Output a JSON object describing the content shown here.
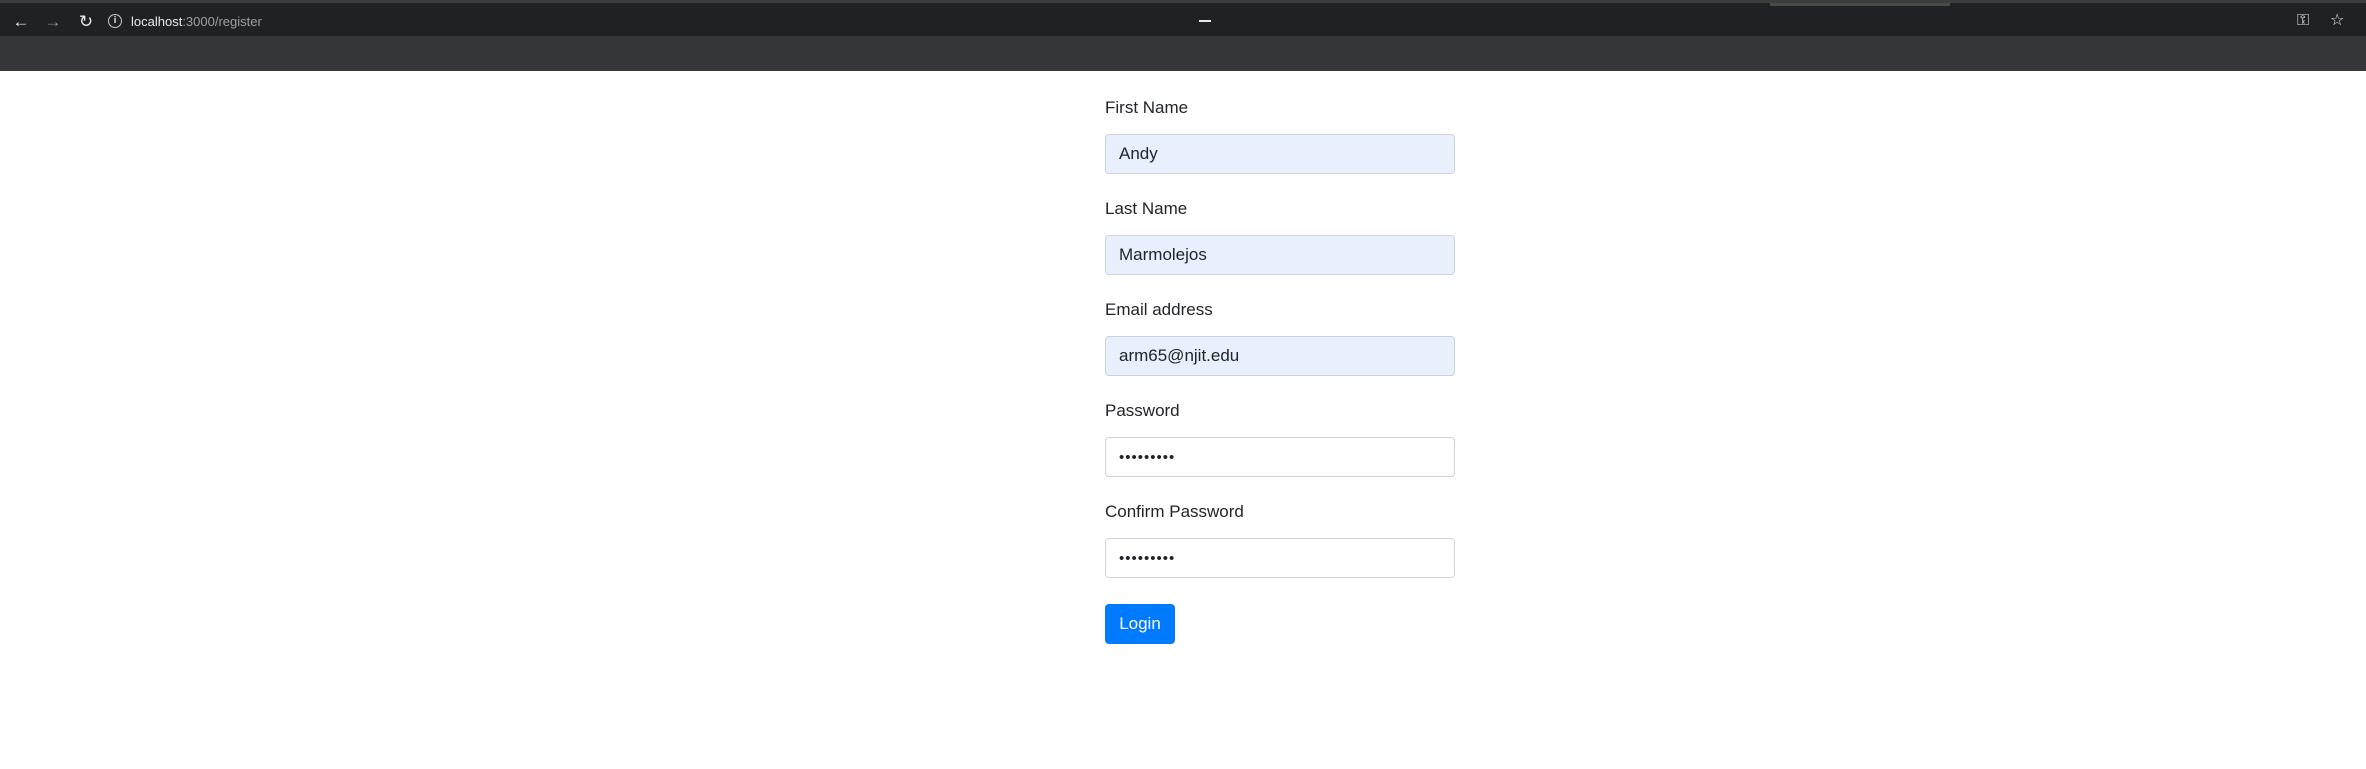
{
  "browser": {
    "url_host": "localhost",
    "url_path": ":3000/register",
    "back_glyph": "←",
    "forward_glyph": "→",
    "reload_glyph": "↻",
    "info_glyph": "i",
    "key_glyph": "⚿",
    "star_glyph": "☆",
    "icons": [
      "back-arrow-icon",
      "forward-arrow-icon",
      "reload-icon",
      "info-icon",
      "minimize-icon",
      "key-icon",
      "bookmark-star-icon"
    ]
  },
  "form": {
    "first_name": {
      "label": "First Name",
      "value": "Andy"
    },
    "last_name": {
      "label": "Last Name",
      "value": "Marmolejos"
    },
    "email": {
      "label": "Email address",
      "value": "arm65@njit.edu"
    },
    "password": {
      "label": "Password",
      "value": "•••••••••"
    },
    "confirm_password": {
      "label": "Confirm Password",
      "value": "•••••••••"
    },
    "submit_label": "Login"
  },
  "colors": {
    "primary": "#007bff",
    "autofill_bg": "#e8f0fe",
    "toolbar_bg": "#202124",
    "bookmark_bar_bg": "#35363a"
  }
}
